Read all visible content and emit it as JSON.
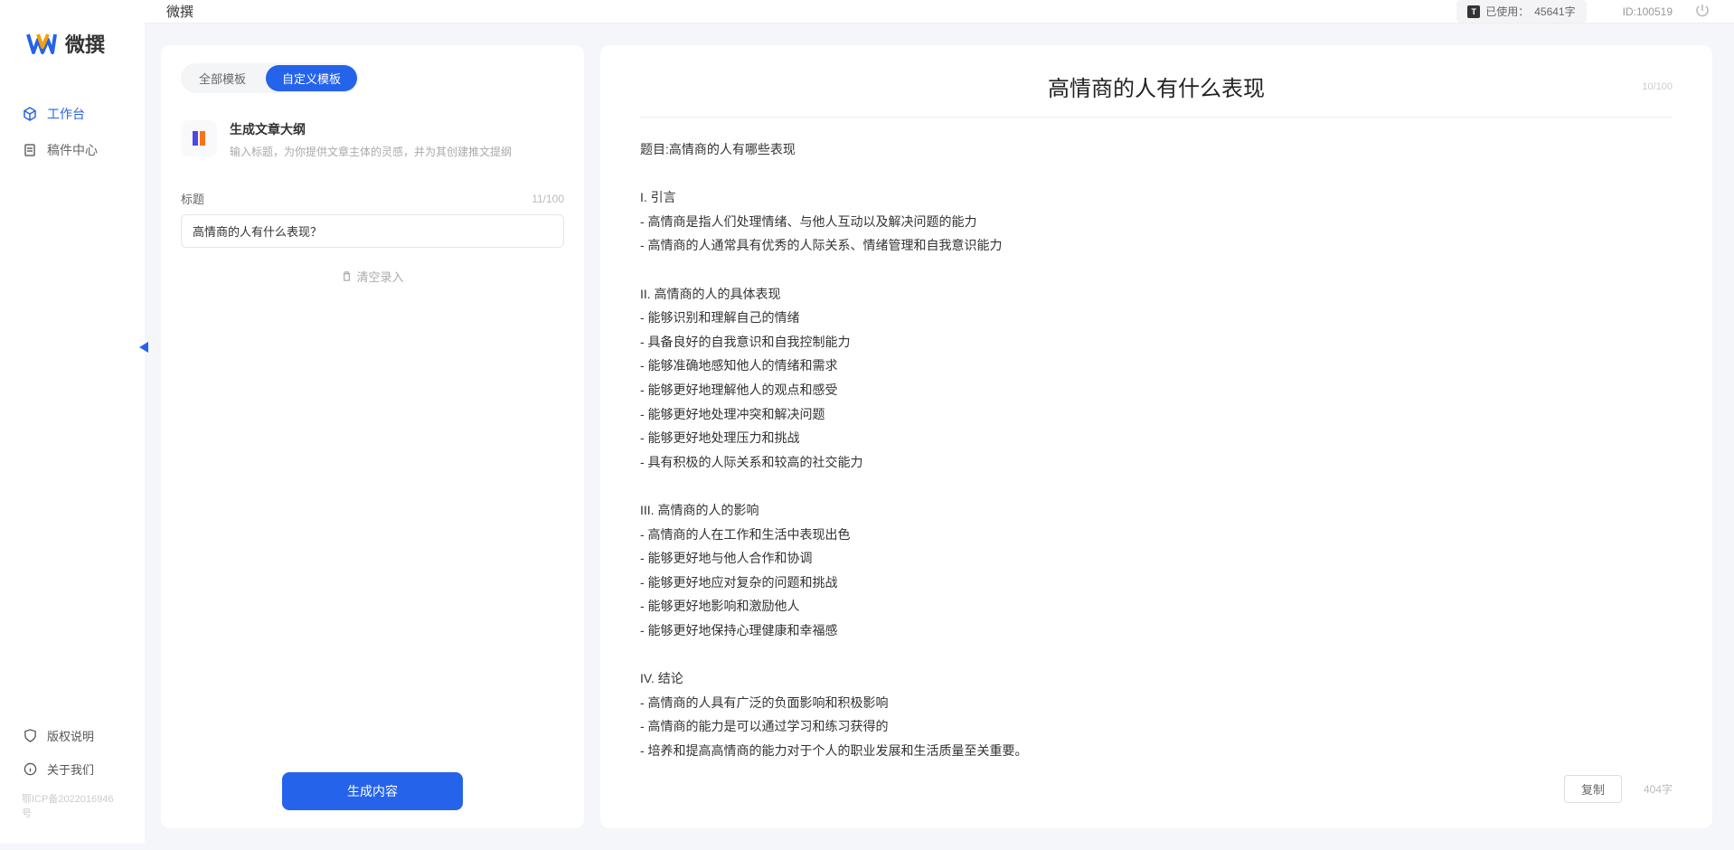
{
  "brand": {
    "name": "微撰"
  },
  "sidebar": {
    "items": [
      {
        "label": "工作台",
        "active": true
      },
      {
        "label": "稿件中心",
        "active": false
      }
    ],
    "bottom": [
      {
        "label": "版权说明"
      },
      {
        "label": "关于我们"
      }
    ],
    "icp": "鄂ICP备2022016946号"
  },
  "topbar": {
    "title": "微撰",
    "usage_prefix": "已使用：",
    "usage_value": "45641字",
    "id_label": "ID:100519"
  },
  "left_panel": {
    "tabs": [
      {
        "label": "全部模板",
        "active": false
      },
      {
        "label": "自定义模板",
        "active": true
      }
    ],
    "template": {
      "title": "生成文章大纲",
      "desc": "输入标题，为你提供文章主体的灵感，并为其创建推文提纲"
    },
    "form": {
      "label": "标题",
      "char_count": "11/100",
      "value": "高情商的人有什么表现？"
    },
    "clear": "清空录入",
    "generate": "生成内容"
  },
  "right_panel": {
    "title": "高情商的人有什么表现",
    "title_count": "10/100",
    "body": "题目:高情商的人有哪些表现\n\nI. 引言\n- 高情商是指人们处理情绪、与他人互动以及解决问题的能力\n- 高情商的人通常具有优秀的人际关系、情绪管理和自我意识能力\n\nII. 高情商的人的具体表现\n- 能够识别和理解自己的情绪\n- 具备良好的自我意识和自我控制能力\n- 能够准确地感知他人的情绪和需求\n- 能够更好地理解他人的观点和感受\n- 能够更好地处理冲突和解决问题\n- 能够更好地处理压力和挑战\n- 具有积极的人际关系和较高的社交能力\n\nIII. 高情商的人的影响\n- 高情商的人在工作和生活中表现出色\n- 能够更好地与他人合作和协调\n- 能够更好地应对复杂的问题和挑战\n- 能够更好地影响和激励他人\n- 能够更好地保持心理健康和幸福感\n\nIV. 结论\n- 高情商的人具有广泛的负面影响和积极影响\n- 高情商的能力是可以通过学习和练习获得的\n- 培养和提高高情商的能力对于个人的职业发展和生活质量至关重要。",
    "copy": "复制",
    "word_count": "404字"
  }
}
